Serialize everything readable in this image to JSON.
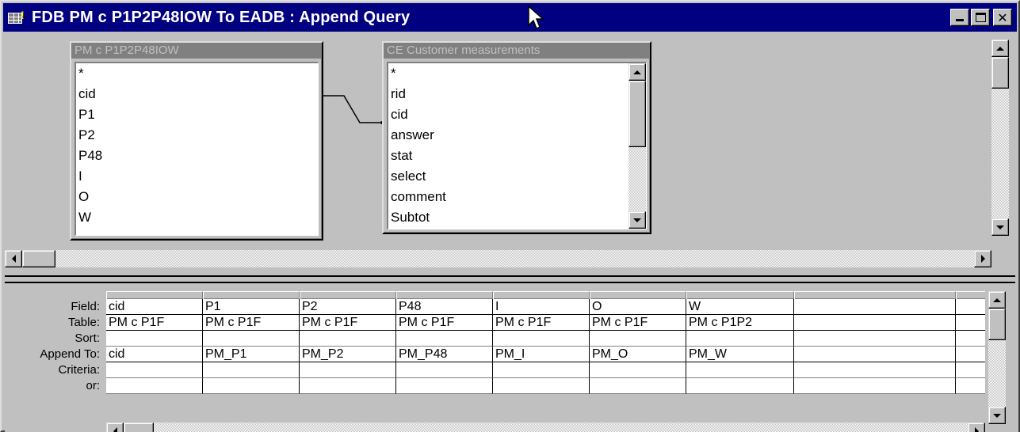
{
  "window": {
    "title": "FDB PM c P1P2P48IOW To EADB : Append Query",
    "icon": "query-grid-icon",
    "controls": [
      "minimize-icon",
      "maximize-icon",
      "close-icon"
    ],
    "close_glyph": "✕"
  },
  "field_lists": [
    {
      "title": "PM c P1P2P48IOW",
      "fields": [
        "*",
        "cid",
        "P1",
        "P2",
        "P48",
        "I",
        "O",
        "W"
      ]
    },
    {
      "title": "CE Customer measurements",
      "fields": [
        "*",
        "rid",
        "cid",
        "answer",
        "stat",
        "select",
        "comment",
        "Subtot"
      ]
    }
  ],
  "grid": {
    "row_labels": {
      "field": "Field:",
      "table": "Table:",
      "sort": "Sort:",
      "append_to": "Append To:",
      "criteria": "Criteria:",
      "or": "or:"
    },
    "columns": [
      {
        "field": "cid",
        "table": "PM c P1F",
        "sort": "",
        "append_to": "cid",
        "criteria": "",
        "or": ""
      },
      {
        "field": "P1",
        "table": "PM c P1F",
        "sort": "",
        "append_to": "PM_P1",
        "criteria": "",
        "or": ""
      },
      {
        "field": "P2",
        "table": "PM c P1F",
        "sort": "",
        "append_to": "PM_P2",
        "criteria": "",
        "or": ""
      },
      {
        "field": "P48",
        "table": "PM c P1F",
        "sort": "",
        "append_to": "PM_P48",
        "criteria": "",
        "or": ""
      },
      {
        "field": "I",
        "table": "PM c P1F",
        "sort": "",
        "append_to": "PM_I",
        "criteria": "",
        "or": ""
      },
      {
        "field": "O",
        "table": "PM c P1F",
        "sort": "",
        "append_to": "PM_O",
        "criteria": "",
        "or": ""
      },
      {
        "field": "W",
        "table": "PM c P1P2",
        "sort": "",
        "append_to": "PM_W",
        "criteria": "",
        "or": ""
      },
      {
        "field": "",
        "table": "",
        "sort": "",
        "append_to": "",
        "criteria": "",
        "or": ""
      },
      {
        "field": "",
        "table": "",
        "sort": "",
        "append_to": "",
        "criteria": "",
        "or": ""
      }
    ]
  },
  "colors": {
    "titlebar": "#000080",
    "face": "#c0c0c0",
    "inactive_caption": "#808080"
  }
}
